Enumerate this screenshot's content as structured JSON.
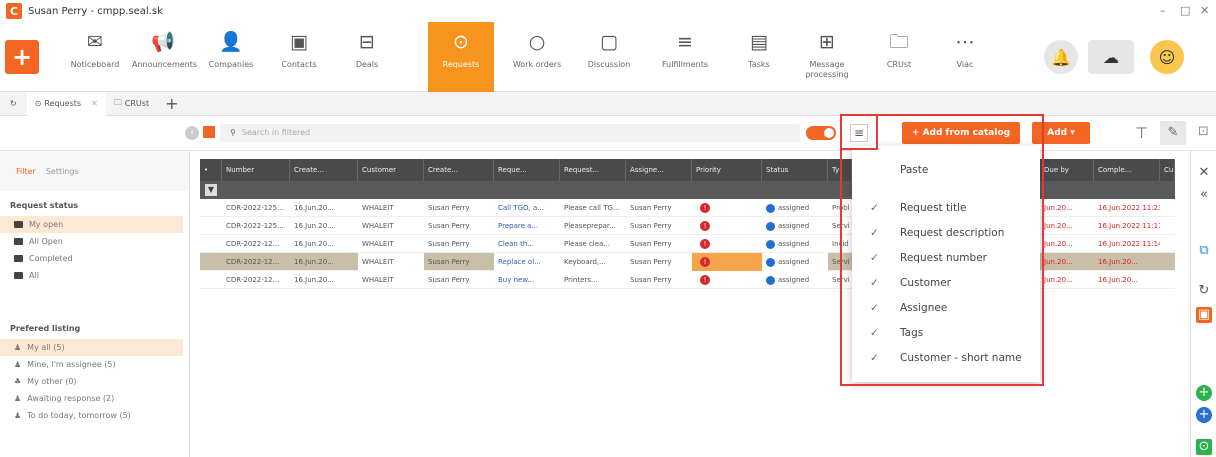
{
  "window": {
    "title": "Susan Perry - cmpp.seal.sk",
    "logo": "C"
  },
  "ribbon": {
    "items": [
      {
        "label": "Noticeboard",
        "icon": "✉"
      },
      {
        "label": "Announcements",
        "icon": "📢"
      },
      {
        "label": "Companies",
        "icon": "👤"
      },
      {
        "label": "Contacts",
        "icon": "▣"
      },
      {
        "label": "Deals",
        "icon": "⊟"
      },
      {
        "label": "Requests",
        "icon": "⊙"
      },
      {
        "label": "Work orders",
        "icon": "○"
      },
      {
        "label": "Discussion",
        "icon": "▢"
      },
      {
        "label": "Fulfillments",
        "icon": "≡"
      },
      {
        "label": "Tasks",
        "icon": "▤"
      },
      {
        "label": "Message processing",
        "icon": "⊞"
      },
      {
        "label": "CRUst",
        "icon": "🗀"
      },
      {
        "label": "Viac",
        "icon": "⋯"
      }
    ]
  },
  "tabs": [
    {
      "label": "Requests"
    },
    {
      "label": "CRUst"
    }
  ],
  "toolbar": {
    "search_placeholder": "Search in filtered",
    "add_catalog": "+ Add from catalog",
    "add": "Add ▾"
  },
  "left_panel": {
    "tab_filter": "Filter",
    "tab_settings": "Settings",
    "request_status_heading": "Request status",
    "status_items": [
      "My open",
      "All Open",
      "Completed",
      "All"
    ],
    "preferred_heading": "Prefered listing",
    "preferred_items": [
      "My all (5)",
      "Mine, I'm assignee (5)",
      "My other (0)",
      "Awaiting response (2)",
      "To do today, tomorrow (5)"
    ]
  },
  "grid": {
    "headers": [
      "Number",
      "Create...",
      "Customer",
      "Create...",
      "Reque...",
      "Request...",
      "Assigne...",
      "Priority",
      "Status",
      "Ty",
      "Due by",
      "Comple...",
      "Cu"
    ],
    "rows": [
      {
        "number": "CDR-2022-125...",
        "created": "16.Jun.20...",
        "customer": "WHALEIT",
        "creator": "Susan Perry",
        "title": "Call TGO, a...",
        "desc": "Please call TG...",
        "assignee": "Susan Perry",
        "priority": "!",
        "status": "assigned",
        "type": "Probl",
        "due": "Jun.20...",
        "completed": "16.Jun.2022 11:23"
      },
      {
        "number": "CDR-2022-125...",
        "created": "16.Jun.20...",
        "customer": "WHALEIT",
        "creator": "Susan Perry",
        "title": "Prepare a...",
        "desc": "Pleaseprepar...",
        "assignee": "Susan Perry",
        "priority": "!",
        "status": "assigned",
        "type": "Servi",
        "due": "Jun.20...",
        "completed": "16.Jun.2022 11:17"
      },
      {
        "number": "CDR-2022-12...",
        "created": "16.Jun.20...",
        "customer": "WHALEIT",
        "creator": "Susan Perry",
        "title": "Clean th...",
        "desc": "Please clea...",
        "assignee": "Susan Perry",
        "priority": "!",
        "status": "assigned",
        "type": "Incid",
        "due": "Jun.20...",
        "completed": "16.Jun.2022 11:14"
      },
      {
        "number": "CDR-2022-12...",
        "created": "16.Jun.20...",
        "customer": "WHALEIT",
        "creator": "Susan Perry",
        "title": "Replace ol...",
        "desc": "Keyboard,...",
        "assignee": "Susan Perry",
        "priority": "!",
        "status": "assigned",
        "type": "Servi",
        "due": "Jun.20...",
        "completed": "16.Jun.20..."
      },
      {
        "number": "CDR-2022-12...",
        "created": "16.Jun.20...",
        "customer": "WHALEIT",
        "creator": "Susan Perry",
        "title": "Buy new...",
        "desc": "Printers...",
        "assignee": "Susan Perry",
        "priority": "!",
        "status": "assigned",
        "type": "Servi",
        "due": "Jun.20...",
        "completed": "16.Jun.20..."
      }
    ]
  },
  "dropdown": {
    "items": [
      {
        "label": "Paste",
        "checked": ""
      },
      {
        "label": "Request title",
        "checked": "✓"
      },
      {
        "label": "Request description",
        "checked": "✓"
      },
      {
        "label": "Request number",
        "checked": "✓"
      },
      {
        "label": "Customer",
        "checked": "✓"
      },
      {
        "label": "Assignee",
        "checked": "✓"
      },
      {
        "label": "Tags",
        "checked": "✓"
      },
      {
        "label": "Customer - short name",
        "checked": "✓"
      }
    ]
  },
  "colors": {
    "accent": "#f26522",
    "highlight": "#e53935",
    "link": "#2a5db0"
  }
}
